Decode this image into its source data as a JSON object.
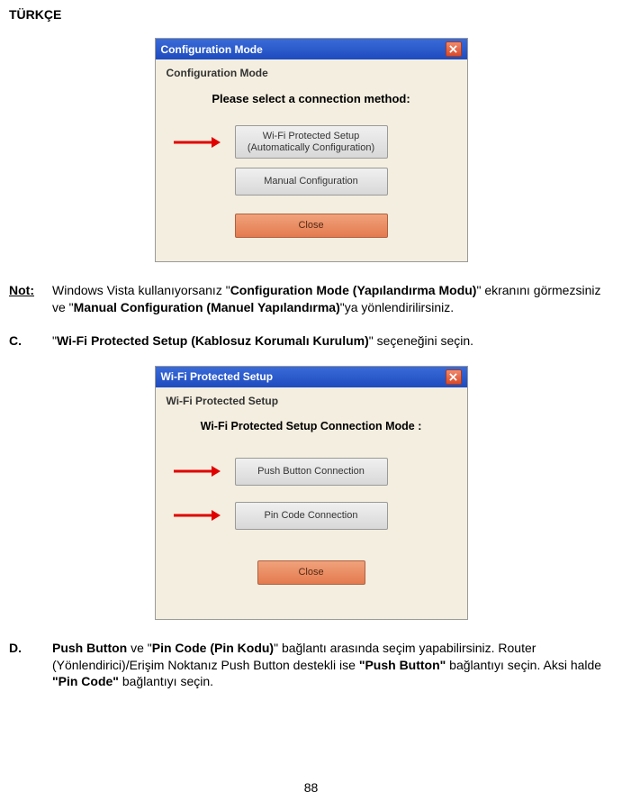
{
  "lang": "TÜRKÇE",
  "dialog1": {
    "title": "Configuration Mode",
    "innerTitle": "Configuration Mode",
    "prompt": "Please select a connection method:",
    "btn1_line1": "Wi-Fi Protected Setup",
    "btn1_line2": "(Automatically Configuration)",
    "btn2": "Manual Configuration",
    "btnClose": "Close"
  },
  "note": {
    "label": "Not:",
    "t1": "Windows Vista kullanıyorsanız \"",
    "b1": "Configuration Mode (Yapılandırma Modu)",
    "t2": "\" ekranını görmezsiniz ve \"",
    "b2": "Manual Configuration (Manuel Yapılandırma)",
    "t3": "\"ya yönlendirilirsiniz."
  },
  "stepC": {
    "label": "C.",
    "t1": "\"",
    "b1": "Wi-Fi Protected Setup (Kablosuz Korumalı Kurulum)",
    "t2": "\" seçeneğini seçin."
  },
  "dialog2": {
    "title": "Wi-Fi Protected Setup",
    "innerTitle": "Wi-Fi Protected Setup",
    "prompt": "Wi-Fi Protected Setup Connection  Mode :",
    "btn1": "Push Button Connection",
    "btn2": "Pin Code Connection",
    "btnClose": "Close"
  },
  "stepD": {
    "label": "D.",
    "b0": "Push Button",
    "t1": " ve \"",
    "b1": "Pin Code (Pin Kodu)",
    "t2": "\" bağlantı arasında seçim yapabilirsiniz. Router (Yönlendirici)/Erişim Noktanız Push Button destekli ise ",
    "b2": "\"Push Button\"",
    "t3": " bağlantıyı seçin. Aksi halde ",
    "b3": "\"Pin Code\"",
    "t4": " bağlantıyı seçin."
  },
  "pageNum": "88"
}
